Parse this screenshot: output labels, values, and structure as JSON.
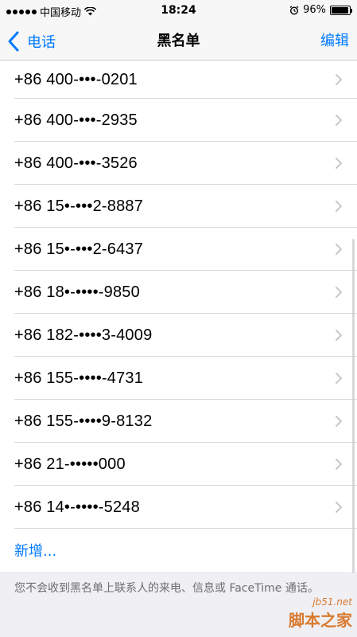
{
  "status_bar": {
    "carrier": "中国移动",
    "time": "18:24",
    "battery_percent": "96%",
    "battery_level": 0.96
  },
  "nav": {
    "back_label": "电话",
    "title": "黑名单",
    "edit_label": "编辑"
  },
  "blocked_numbers": [
    "+86 400-•••-0201",
    "+86 400-•••-2935",
    "+86 400-•••-3526",
    "+86 15•-•••2-8887",
    "+86 15•-•••2-6437",
    "+86 18•-••••-9850",
    "+86 182-••••3-4009",
    "+86 155-••••-4731",
    "+86 155-••••9-8132",
    "+86 21-•••••000",
    "+86 14•-••••-5248"
  ],
  "add_label": "新增...",
  "footer_note": "您不会收到黑名单上联系人的来电、信息或 FaceTime 通话。",
  "watermark": {
    "site": "jb51.net",
    "name": "脚本之家"
  }
}
